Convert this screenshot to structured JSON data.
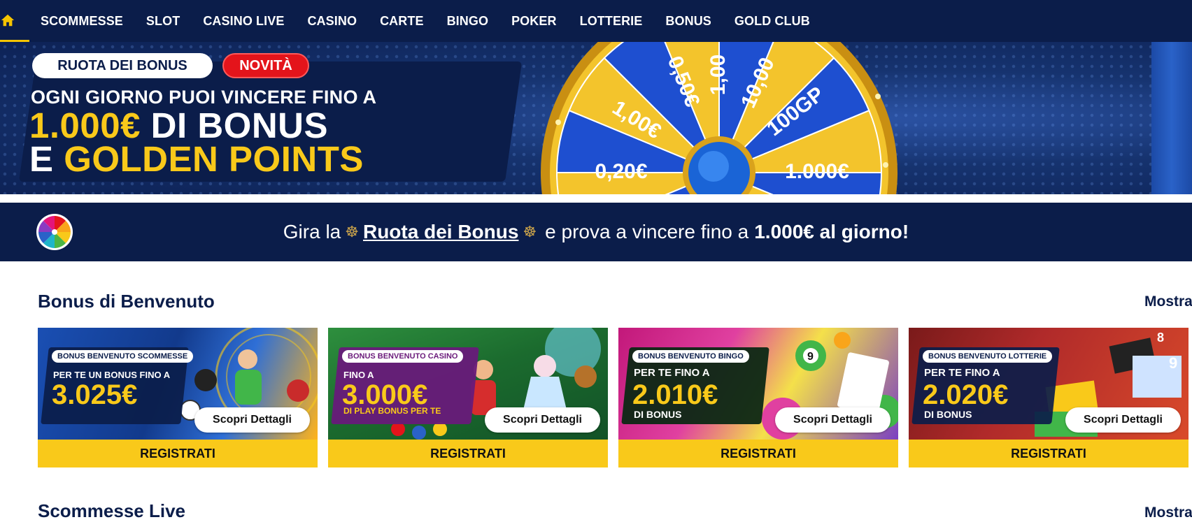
{
  "nav": {
    "home_icon": "home-icon",
    "items": [
      {
        "label": "SCOMMESSE"
      },
      {
        "label": "SLOT"
      },
      {
        "label": "CASINO LIVE"
      },
      {
        "label": "CASINO"
      },
      {
        "label": "CARTE"
      },
      {
        "label": "BINGO"
      },
      {
        "label": "POKER"
      },
      {
        "label": "LOTTERIE"
      },
      {
        "label": "BONUS"
      },
      {
        "label": "GOLD CLUB"
      }
    ]
  },
  "hero": {
    "tag": "RUOTA DEI BONUS",
    "badge": "NOVITÀ",
    "line1": "OGNI GIORNO PUOI VINCERE FINO A",
    "line2_highlight": "1.000€",
    "line2_rest": " DI BONUS",
    "line3_prefix": "E ",
    "line3_highlight": "GOLDEN POINTS",
    "wheel_labels": [
      "0,50€",
      "1,00",
      "10,00",
      "100GP",
      "1.000€",
      "0,20€",
      "0,20€",
      "1,00€",
      "0,20€"
    ]
  },
  "promo": {
    "prefix": "Gira la",
    "link": "Ruota dei Bonus",
    "middle": "e prova a vincere fino a",
    "bold": "1.000€ al giorno!"
  },
  "section": {
    "title": "Bonus di Benvenuto",
    "more": "Mostra"
  },
  "cards": [
    {
      "tag": "BONUS BENVENUTO SCOMMESSE",
      "pre": "PER TE UN BONUS FINO A",
      "amount": "3.025€",
      "post": "",
      "button": "Scopri Dettagli",
      "register": "REGISTRATI"
    },
    {
      "tag": "BONUS BENVENUTO CASINO",
      "pre": "FINO A",
      "amount": "3.000€",
      "post": "DI PLAY BONUS PER TE",
      "button": "Scopri Dettagli",
      "register": "REGISTRATI"
    },
    {
      "tag": "BONUS BENVENUTO BINGO",
      "pre": "PER TE FINO A",
      "amount": "2.010€",
      "post": "DI BONUS",
      "button": "Scopri Dettagli",
      "register": "REGISTRATI"
    },
    {
      "tag": "BONUS BENVENUTO LOTTERIE",
      "pre": "PER TE FINO A",
      "amount": "2.020€",
      "post": "DI BONUS",
      "button": "Scopri Dettagli",
      "register": "REGISTRATI"
    }
  ],
  "next_section": {
    "title": "Scommesse Live",
    "more": "Mostra"
  },
  "colors": {
    "navy": "#0b1d4a",
    "yellow": "#f9c91a",
    "red": "#e4141b"
  }
}
